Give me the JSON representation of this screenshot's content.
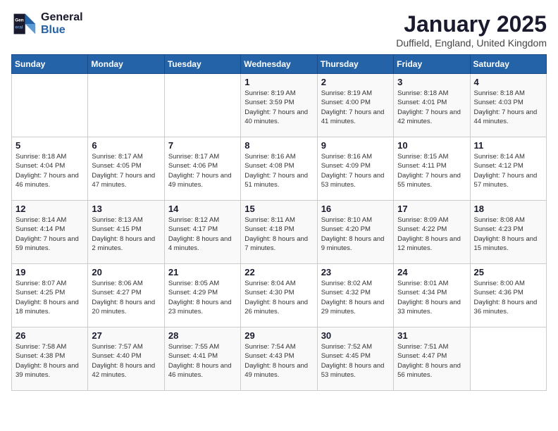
{
  "header": {
    "logo_line1": "General",
    "logo_line2": "Blue",
    "month": "January 2025",
    "location": "Duffield, England, United Kingdom"
  },
  "days_of_week": [
    "Sunday",
    "Monday",
    "Tuesday",
    "Wednesday",
    "Thursday",
    "Friday",
    "Saturday"
  ],
  "weeks": [
    [
      {
        "day": "",
        "sunrise": "",
        "sunset": "",
        "daylight": ""
      },
      {
        "day": "",
        "sunrise": "",
        "sunset": "",
        "daylight": ""
      },
      {
        "day": "",
        "sunrise": "",
        "sunset": "",
        "daylight": ""
      },
      {
        "day": "1",
        "sunrise": "Sunrise: 8:19 AM",
        "sunset": "Sunset: 3:59 PM",
        "daylight": "Daylight: 7 hours and 40 minutes."
      },
      {
        "day": "2",
        "sunrise": "Sunrise: 8:19 AM",
        "sunset": "Sunset: 4:00 PM",
        "daylight": "Daylight: 7 hours and 41 minutes."
      },
      {
        "day": "3",
        "sunrise": "Sunrise: 8:18 AM",
        "sunset": "Sunset: 4:01 PM",
        "daylight": "Daylight: 7 hours and 42 minutes."
      },
      {
        "day": "4",
        "sunrise": "Sunrise: 8:18 AM",
        "sunset": "Sunset: 4:03 PM",
        "daylight": "Daylight: 7 hours and 44 minutes."
      }
    ],
    [
      {
        "day": "5",
        "sunrise": "Sunrise: 8:18 AM",
        "sunset": "Sunset: 4:04 PM",
        "daylight": "Daylight: 7 hours and 46 minutes."
      },
      {
        "day": "6",
        "sunrise": "Sunrise: 8:17 AM",
        "sunset": "Sunset: 4:05 PM",
        "daylight": "Daylight: 7 hours and 47 minutes."
      },
      {
        "day": "7",
        "sunrise": "Sunrise: 8:17 AM",
        "sunset": "Sunset: 4:06 PM",
        "daylight": "Daylight: 7 hours and 49 minutes."
      },
      {
        "day": "8",
        "sunrise": "Sunrise: 8:16 AM",
        "sunset": "Sunset: 4:08 PM",
        "daylight": "Daylight: 7 hours and 51 minutes."
      },
      {
        "day": "9",
        "sunrise": "Sunrise: 8:16 AM",
        "sunset": "Sunset: 4:09 PM",
        "daylight": "Daylight: 7 hours and 53 minutes."
      },
      {
        "day": "10",
        "sunrise": "Sunrise: 8:15 AM",
        "sunset": "Sunset: 4:11 PM",
        "daylight": "Daylight: 7 hours and 55 minutes."
      },
      {
        "day": "11",
        "sunrise": "Sunrise: 8:14 AM",
        "sunset": "Sunset: 4:12 PM",
        "daylight": "Daylight: 7 hours and 57 minutes."
      }
    ],
    [
      {
        "day": "12",
        "sunrise": "Sunrise: 8:14 AM",
        "sunset": "Sunset: 4:14 PM",
        "daylight": "Daylight: 7 hours and 59 minutes."
      },
      {
        "day": "13",
        "sunrise": "Sunrise: 8:13 AM",
        "sunset": "Sunset: 4:15 PM",
        "daylight": "Daylight: 8 hours and 2 minutes."
      },
      {
        "day": "14",
        "sunrise": "Sunrise: 8:12 AM",
        "sunset": "Sunset: 4:17 PM",
        "daylight": "Daylight: 8 hours and 4 minutes."
      },
      {
        "day": "15",
        "sunrise": "Sunrise: 8:11 AM",
        "sunset": "Sunset: 4:18 PM",
        "daylight": "Daylight: 8 hours and 7 minutes."
      },
      {
        "day": "16",
        "sunrise": "Sunrise: 8:10 AM",
        "sunset": "Sunset: 4:20 PM",
        "daylight": "Daylight: 8 hours and 9 minutes."
      },
      {
        "day": "17",
        "sunrise": "Sunrise: 8:09 AM",
        "sunset": "Sunset: 4:22 PM",
        "daylight": "Daylight: 8 hours and 12 minutes."
      },
      {
        "day": "18",
        "sunrise": "Sunrise: 8:08 AM",
        "sunset": "Sunset: 4:23 PM",
        "daylight": "Daylight: 8 hours and 15 minutes."
      }
    ],
    [
      {
        "day": "19",
        "sunrise": "Sunrise: 8:07 AM",
        "sunset": "Sunset: 4:25 PM",
        "daylight": "Daylight: 8 hours and 18 minutes."
      },
      {
        "day": "20",
        "sunrise": "Sunrise: 8:06 AM",
        "sunset": "Sunset: 4:27 PM",
        "daylight": "Daylight: 8 hours and 20 minutes."
      },
      {
        "day": "21",
        "sunrise": "Sunrise: 8:05 AM",
        "sunset": "Sunset: 4:29 PM",
        "daylight": "Daylight: 8 hours and 23 minutes."
      },
      {
        "day": "22",
        "sunrise": "Sunrise: 8:04 AM",
        "sunset": "Sunset: 4:30 PM",
        "daylight": "Daylight: 8 hours and 26 minutes."
      },
      {
        "day": "23",
        "sunrise": "Sunrise: 8:02 AM",
        "sunset": "Sunset: 4:32 PM",
        "daylight": "Daylight: 8 hours and 29 minutes."
      },
      {
        "day": "24",
        "sunrise": "Sunrise: 8:01 AM",
        "sunset": "Sunset: 4:34 PM",
        "daylight": "Daylight: 8 hours and 33 minutes."
      },
      {
        "day": "25",
        "sunrise": "Sunrise: 8:00 AM",
        "sunset": "Sunset: 4:36 PM",
        "daylight": "Daylight: 8 hours and 36 minutes."
      }
    ],
    [
      {
        "day": "26",
        "sunrise": "Sunrise: 7:58 AM",
        "sunset": "Sunset: 4:38 PM",
        "daylight": "Daylight: 8 hours and 39 minutes."
      },
      {
        "day": "27",
        "sunrise": "Sunrise: 7:57 AM",
        "sunset": "Sunset: 4:40 PM",
        "daylight": "Daylight: 8 hours and 42 minutes."
      },
      {
        "day": "28",
        "sunrise": "Sunrise: 7:55 AM",
        "sunset": "Sunset: 4:41 PM",
        "daylight": "Daylight: 8 hours and 46 minutes."
      },
      {
        "day": "29",
        "sunrise": "Sunrise: 7:54 AM",
        "sunset": "Sunset: 4:43 PM",
        "daylight": "Daylight: 8 hours and 49 minutes."
      },
      {
        "day": "30",
        "sunrise": "Sunrise: 7:52 AM",
        "sunset": "Sunset: 4:45 PM",
        "daylight": "Daylight: 8 hours and 53 minutes."
      },
      {
        "day": "31",
        "sunrise": "Sunrise: 7:51 AM",
        "sunset": "Sunset: 4:47 PM",
        "daylight": "Daylight: 8 hours and 56 minutes."
      },
      {
        "day": "",
        "sunrise": "",
        "sunset": "",
        "daylight": ""
      }
    ]
  ]
}
